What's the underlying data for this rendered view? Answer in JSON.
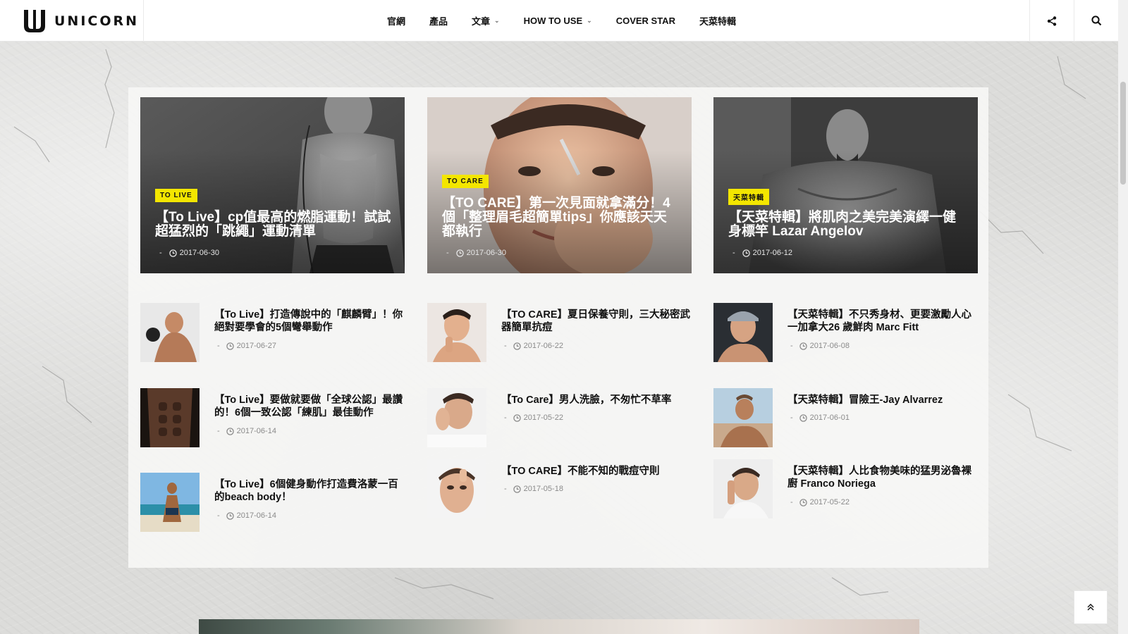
{
  "brand": {
    "name": "UNICORN"
  },
  "nav": {
    "items": [
      {
        "label": "官網",
        "has_dropdown": false
      },
      {
        "label": "產品",
        "has_dropdown": false
      },
      {
        "label": "文章",
        "has_dropdown": true
      },
      {
        "label": "HOW TO USE",
        "has_dropdown": true
      },
      {
        "label": "COVER STAR",
        "has_dropdown": false
      },
      {
        "label": "天菜特輯",
        "has_dropdown": false
      }
    ],
    "share_icon": "share-icon",
    "search_icon": "search-icon"
  },
  "featured": [
    {
      "badge": "TO LIVE",
      "title": "【To Live】cp值最高的燃脂運動！試試超猛烈的「跳繩」運動清單",
      "dash": "-",
      "date": "2017-06-30"
    },
    {
      "badge": "TO CARE",
      "title": "【TO CARE】第一次見面就拿滿分！4個「整理眉毛超簡單tips」你應該天天都執行",
      "dash": "-",
      "date": "2017-06-30"
    },
    {
      "badge": "天菜特輯",
      "title": "【天菜特輯】將肌肉之美完美演繹一健身標竿 Lazar Angelov",
      "dash": "-",
      "date": "2017-06-12"
    }
  ],
  "columns": [
    [
      {
        "title": "【To Live】打造傳說中的「麒麟臂」！你絕對要學會的5個彎舉動作",
        "dash": "-",
        "date": "2017-06-27"
      },
      {
        "title": "【To Live】要做就要做「全球公認」最讚的！6個一致公認「練肌」最佳動作",
        "dash": "-",
        "date": "2017-06-14"
      },
      {
        "title": "【To Live】6個健身動作打造費洛蒙一百的beach body！",
        "dash": "-",
        "date": "2017-06-14"
      }
    ],
    [
      {
        "title": "【TO CARE】夏日保養守則，三大秘密武器簡單抗痘",
        "dash": "-",
        "date": "2017-06-22"
      },
      {
        "title": "【To Care】男人洗臉，不匆忙不草率",
        "dash": "-",
        "date": "2017-05-22"
      },
      {
        "title": "【TO CARE】不能不知的戰痘守則",
        "dash": "-",
        "date": "2017-05-18"
      }
    ],
    [
      {
        "title": "【天菜特輯】不只秀身材、更要激勵人心一加拿大26 歲鮮肉 Marc Fitt",
        "dash": "-",
        "date": "2017-06-08"
      },
      {
        "title": "【天菜特輯】冒險王-Jay Alvarrez",
        "dash": "-",
        "date": "2017-06-01"
      },
      {
        "title": "【天菜特輯】人比食物美味的猛男泌魯裸廚 Franco Noriega",
        "dash": "-",
        "date": "2017-05-22"
      }
    ]
  ],
  "colors": {
    "badge": "#f3e600",
    "header_bg": "#ffffff",
    "text": "#111111",
    "date": "#8a8a8a"
  },
  "back_to_top_icon": "chevron-up-icon"
}
